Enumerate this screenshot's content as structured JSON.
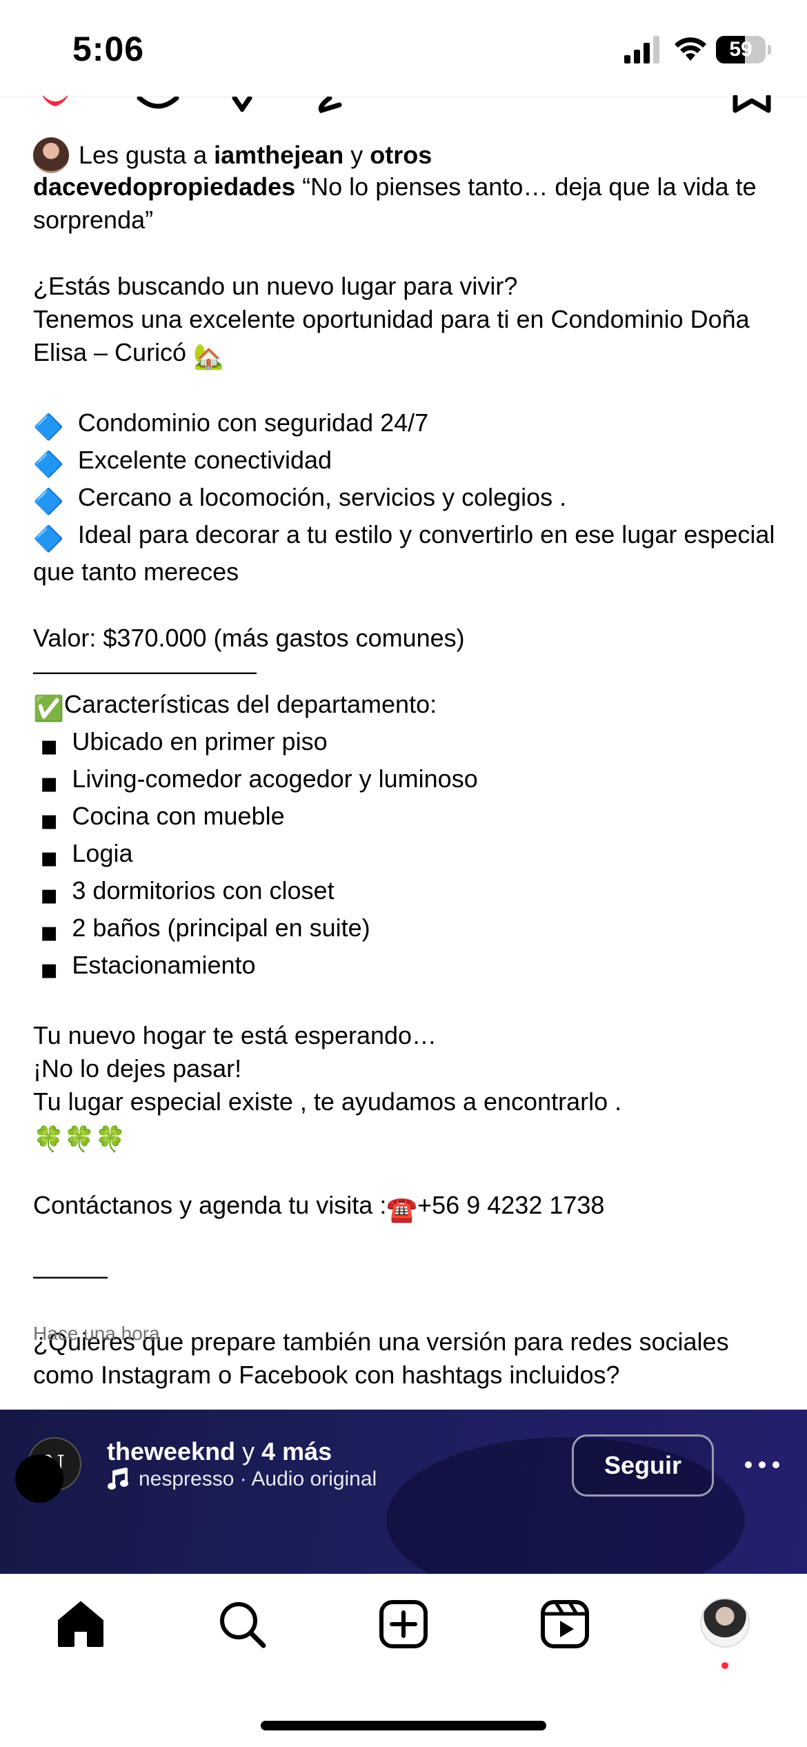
{
  "status_bar": {
    "time": "5:06",
    "battery": "59",
    "battery_level": 0.59
  },
  "post": {
    "liked_by": {
      "prefix": "Les gusta a",
      "user": "iamthejean",
      "joiner": "y",
      "others": "otros"
    },
    "caption": {
      "username": "dacevedopropiedades",
      "quote": "“No lo pienses tanto… deja que la vida te sorprenda”",
      "intro_1": "¿Estás buscando un nuevo lugar para vivir?",
      "intro_2": "Tenemos una excelente oportunidad para ti en Condominio Doña Elisa – Curicó",
      "house_emoji": "🏡",
      "diamond_emoji": "🔷",
      "features": [
        "Condominio con seguridad 24/7",
        "Excelente conectividad",
        "Cercano a locomoción, servicios y colegios .",
        "Ideal para decorar a tu estilo y convertirlo en ese lugar especial que tanto mereces"
      ],
      "price": "Valor: $370.000 (más gastos comunes)",
      "divider_1": "—————————",
      "check_emoji": "✅",
      "characteristics_title": "Características del departamento:",
      "square_emoji": "◾",
      "characteristics": [
        "Ubicado en primer piso",
        "Living-comedor acogedor y luminoso",
        "Cocina con mueble",
        "Logia",
        "3 dormitorios con closet",
        "2 baños (principal en suite)",
        "Estacionamiento"
      ],
      "closing_1": "Tu nuevo hogar te está esperando…",
      "closing_2": "¡No lo dejes pasar!",
      "closing_3": "Tu lugar especial existe , te ayudamos a encontrarlo .",
      "clovers": "🍀🍀🍀",
      "contact_prefix": "Contáctanos y agenda tu visita :",
      "phone_emoji": "☎️",
      "phone": "+56 9 4232 1738",
      "divider_2": "———",
      "question": "¿Quieres que prepare también una versión para redes sociales como Instagram o Facebook con hashtags incluidos?"
    },
    "timestamp": "Hace una hora"
  },
  "reel": {
    "avatar_letter": "N",
    "user": "theweeknd",
    "joiner": "y",
    "more": "4 más",
    "audio": "nespresso · Audio original",
    "follow_label": "Seguir"
  },
  "nav": {
    "icons": [
      "home-icon",
      "search-icon",
      "create-icon",
      "reels-icon",
      "profile-avatar"
    ]
  },
  "colors": {
    "reel_bg": "#1c1e5c",
    "notification_dot": "#ff2d3f",
    "meta_text": "#737373"
  }
}
